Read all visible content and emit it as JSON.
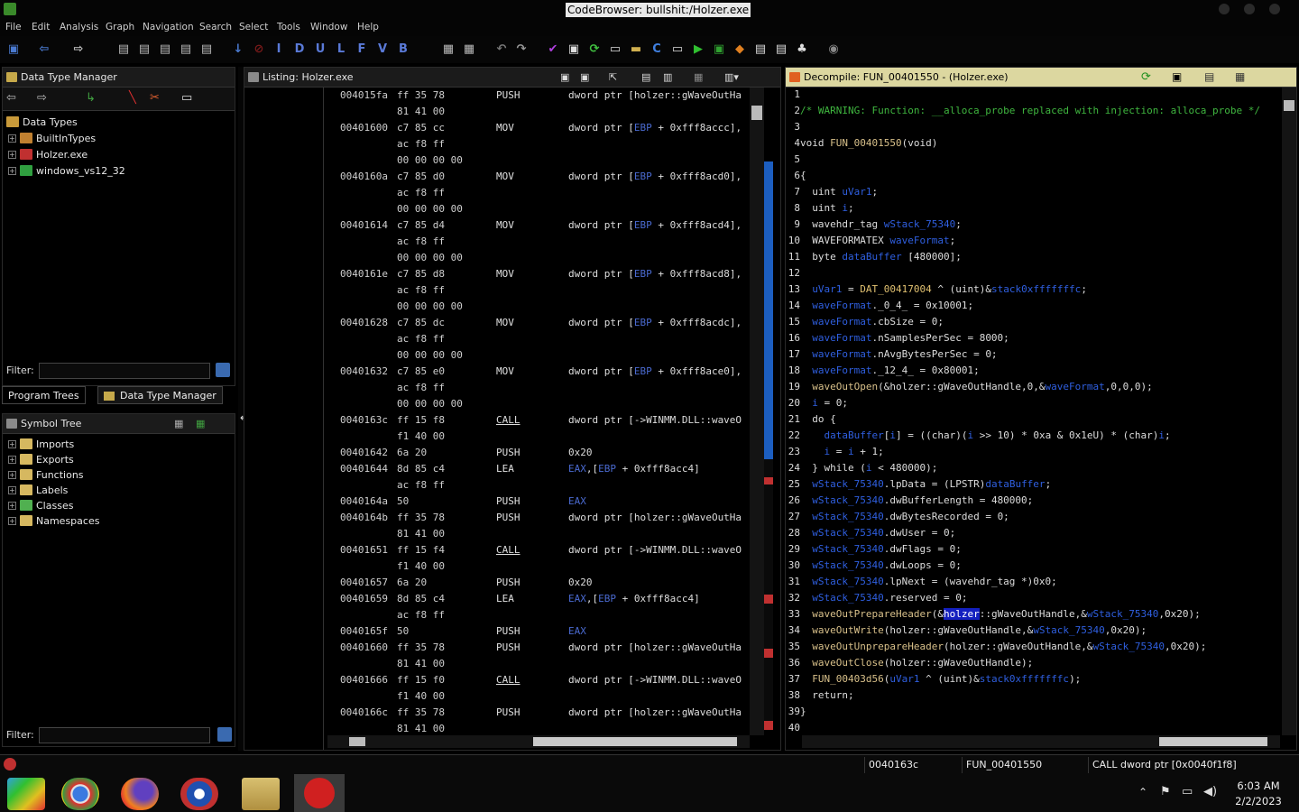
{
  "window": {
    "title": "CodeBrowser: bullshit:/Holzer.exe"
  },
  "menu": [
    "File",
    "Edit",
    "Analysis",
    "Graph",
    "Navigation",
    "Search",
    "Select",
    "Tools",
    "Window",
    "Help"
  ],
  "toolbar": {
    "letters": [
      "I",
      "D",
      "U",
      "L",
      "F",
      "V",
      "B"
    ]
  },
  "dtm": {
    "title": "Data Type Manager",
    "root": "Data Types",
    "items": [
      "BuiltInTypes",
      "Holzer.exe",
      "windows_vs12_32"
    ],
    "filter_label": "Filter:"
  },
  "tabs": {
    "program_trees": "Program Trees",
    "data_type_manager": "Data Type Manager"
  },
  "symbol_tree": {
    "title": "Symbol Tree",
    "items": [
      "Imports",
      "Exports",
      "Functions",
      "Labels",
      "Classes",
      "Namespaces"
    ],
    "filter_label": "Filter:"
  },
  "listing": {
    "title": "Listing:  Holzer.exe",
    "rows": [
      {
        "addr": "004015fa",
        "bytes": "ff 35 78",
        "mn": "PUSH",
        "op": "dword ptr [holzer::gWaveOutHa"
      },
      {
        "addr": "",
        "bytes": "81 41 00",
        "mn": "",
        "op": ""
      },
      {
        "addr": "00401600",
        "bytes": "c7 85 cc",
        "mn": "MOV",
        "op": "dword ptr [EBP + 0xfff8accc],"
      },
      {
        "addr": "",
        "bytes": "ac f8 ff",
        "mn": "",
        "op": ""
      },
      {
        "addr": "",
        "bytes": "00 00 00 00",
        "mn": "",
        "op": ""
      },
      {
        "addr": "0040160a",
        "bytes": "c7 85 d0",
        "mn": "MOV",
        "op": "dword ptr [EBP + 0xfff8acd0],"
      },
      {
        "addr": "",
        "bytes": "ac f8 ff",
        "mn": "",
        "op": ""
      },
      {
        "addr": "",
        "bytes": "00 00 00 00",
        "mn": "",
        "op": ""
      },
      {
        "addr": "00401614",
        "bytes": "c7 85 d4",
        "mn": "MOV",
        "op": "dword ptr [EBP + 0xfff8acd4],"
      },
      {
        "addr": "",
        "bytes": "ac f8 ff",
        "mn": "",
        "op": ""
      },
      {
        "addr": "",
        "bytes": "00 00 00 00",
        "mn": "",
        "op": ""
      },
      {
        "addr": "0040161e",
        "bytes": "c7 85 d8",
        "mn": "MOV",
        "op": "dword ptr [EBP + 0xfff8acd8],"
      },
      {
        "addr": "",
        "bytes": "ac f8 ff",
        "mn": "",
        "op": ""
      },
      {
        "addr": "",
        "bytes": "00 00 00 00",
        "mn": "",
        "op": ""
      },
      {
        "addr": "00401628",
        "bytes": "c7 85 dc",
        "mn": "MOV",
        "op": "dword ptr [EBP + 0xfff8acdc],"
      },
      {
        "addr": "",
        "bytes": "ac f8 ff",
        "mn": "",
        "op": ""
      },
      {
        "addr": "",
        "bytes": "00 00 00 00",
        "mn": "",
        "op": ""
      },
      {
        "addr": "00401632",
        "bytes": "c7 85 e0",
        "mn": "MOV",
        "op": "dword ptr [EBP + 0xfff8ace0],"
      },
      {
        "addr": "",
        "bytes": "ac f8 ff",
        "mn": "",
        "op": ""
      },
      {
        "addr": "",
        "bytes": "00 00 00 00",
        "mn": "",
        "op": ""
      },
      {
        "addr": "0040163c",
        "bytes": "ff 15 f8",
        "mn": "CALL",
        "op": "dword ptr [->WINMM.DLL::waveO"
      },
      {
        "addr": "",
        "bytes": "f1 40 00",
        "mn": "",
        "op": ""
      },
      {
        "addr": "00401642",
        "bytes": "6a 20",
        "mn": "PUSH",
        "op": "0x20"
      },
      {
        "addr": "00401644",
        "bytes": "8d 85 c4",
        "mn": "LEA",
        "op": "EAX,[EBP + 0xfff8acc4]"
      },
      {
        "addr": "",
        "bytes": "ac f8 ff",
        "mn": "",
        "op": ""
      },
      {
        "addr": "0040164a",
        "bytes": "50",
        "mn": "PUSH",
        "op": "EAX"
      },
      {
        "addr": "0040164b",
        "bytes": "ff 35 78",
        "mn": "PUSH",
        "op": "dword ptr [holzer::gWaveOutHa"
      },
      {
        "addr": "",
        "bytes": "81 41 00",
        "mn": "",
        "op": ""
      },
      {
        "addr": "00401651",
        "bytes": "ff 15 f4",
        "mn": "CALL",
        "op": "dword ptr [->WINMM.DLL::waveO"
      },
      {
        "addr": "",
        "bytes": "f1 40 00",
        "mn": "",
        "op": ""
      },
      {
        "addr": "00401657",
        "bytes": "6a 20",
        "mn": "PUSH",
        "op": "0x20"
      },
      {
        "addr": "00401659",
        "bytes": "8d 85 c4",
        "mn": "LEA",
        "op": "EAX,[EBP + 0xfff8acc4]"
      },
      {
        "addr": "",
        "bytes": "ac f8 ff",
        "mn": "",
        "op": ""
      },
      {
        "addr": "0040165f",
        "bytes": "50",
        "mn": "PUSH",
        "op": "EAX"
      },
      {
        "addr": "00401660",
        "bytes": "ff 35 78",
        "mn": "PUSH",
        "op": "dword ptr [holzer::gWaveOutHa"
      },
      {
        "addr": "",
        "bytes": "81 41 00",
        "mn": "",
        "op": ""
      },
      {
        "addr": "00401666",
        "bytes": "ff 15 f0",
        "mn": "CALL",
        "op": "dword ptr [->WINMM.DLL::waveO"
      },
      {
        "addr": "",
        "bytes": "f1 40 00",
        "mn": "",
        "op": ""
      },
      {
        "addr": "0040166c",
        "bytes": "ff 35 78",
        "mn": "PUSH",
        "op": "dword ptr [holzer::gWaveOutHa"
      },
      {
        "addr": "",
        "bytes": "81 41 00",
        "mn": "",
        "op": ""
      }
    ]
  },
  "decompile": {
    "title": "Decompile: FUN_00401550 -  (Holzer.exe)",
    "lines": [
      "",
      "/* WARNING: Function: __alloca_probe replaced with injection: alloca_probe */",
      "",
      "void FUN_00401550(void)",
      "",
      "{",
      "  uint uVar1;",
      "  uint i;",
      "  wavehdr_tag wStack_75340;",
      "  WAVEFORMATEX waveFormat;",
      "  byte dataBuffer [480000];",
      "",
      "  uVar1 = DAT_00417004 ^ (uint)&stack0xfffffffc;",
      "  waveFormat._0_4_ = 0x10001;",
      "  waveFormat.cbSize = 0;",
      "  waveFormat.nSamplesPerSec = 8000;",
      "  waveFormat.nAvgBytesPerSec = 0;",
      "  waveFormat._12_4_ = 0x80001;",
      "  waveOutOpen(&holzer::gWaveOutHandle,0,&waveFormat,0,0,0);",
      "  i = 0;",
      "  do {",
      "    dataBuffer[i] = ((char)(i >> 10) * 0xa & 0x1eU) * (char)i;",
      "    i = i + 1;",
      "  } while (i < 480000);",
      "  wStack_75340.lpData = (LPSTR)dataBuffer;",
      "  wStack_75340.dwBufferLength = 480000;",
      "  wStack_75340.dwBytesRecorded = 0;",
      "  wStack_75340.dwUser = 0;",
      "  wStack_75340.dwFlags = 0;",
      "  wStack_75340.dwLoops = 0;",
      "  wStack_75340.lpNext = (wavehdr_tag *)0x0;",
      "  wStack_75340.reserved = 0;",
      "  waveOutPrepareHeader(&holzer::gWaveOutHandle,&wStack_75340,0x20);",
      "  waveOutWrite(holzer::gWaveOutHandle,&wStack_75340,0x20);",
      "  waveOutUnprepareHeader(holzer::gWaveOutHandle,&wStack_75340,0x20);",
      "  waveOutClose(holzer::gWaveOutHandle);",
      "  FUN_00403d56(uVar1 ^ (uint)&stack0xfffffffc);",
      "  return;",
      "}",
      ""
    ]
  },
  "status": {
    "address": "0040163c",
    "function": "FUN_00401550",
    "instruction": "CALL dword ptr [0x0040f1f8]"
  },
  "clock": {
    "time": "6:03 AM",
    "date": "2/2/2023"
  },
  "colors": {
    "accent": "#1420c0",
    "comment": "#3fb63f",
    "variable": "#2f5fe0",
    "function": "#d8c08a",
    "decomp_header": "#dcd7a0"
  }
}
